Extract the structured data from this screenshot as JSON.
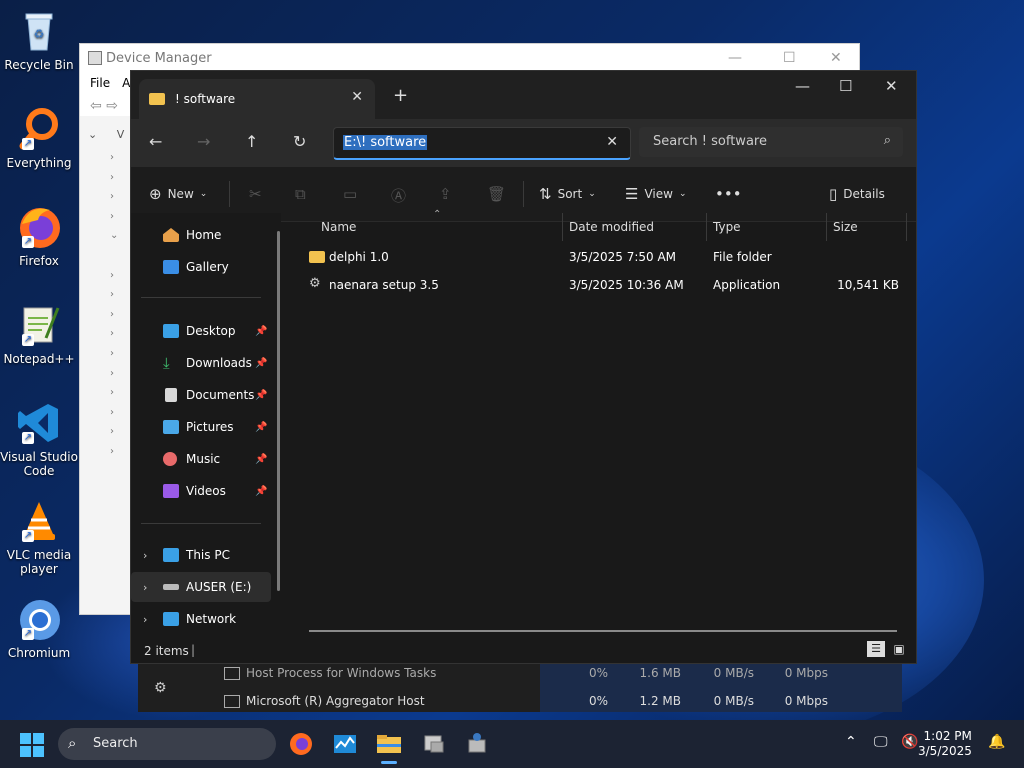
{
  "desktop": {
    "icons": [
      {
        "label": "Recycle Bin"
      },
      {
        "label": "Everything"
      },
      {
        "label": "Firefox"
      },
      {
        "label": "Notepad++"
      },
      {
        "label": "Visual Studio Code"
      },
      {
        "label": "VLC media player"
      },
      {
        "label": "Chromium"
      }
    ]
  },
  "device_manager": {
    "title": "Device Manager",
    "menu": [
      "File",
      "A"
    ],
    "tree_partial": [
      "V"
    ]
  },
  "task_manager": {
    "rows": [
      {
        "name": "Host Process for Windows Tasks",
        "cpu": "0%",
        "memory": "1.6 MB",
        "disk": "0 MB/s",
        "network": "0 Mbps"
      },
      {
        "name": "Microsoft (R) Aggregator Host",
        "cpu": "0%",
        "memory": "1.2 MB",
        "disk": "0 MB/s",
        "network": "0 Mbps"
      }
    ]
  },
  "explorer": {
    "tab_title": "! software",
    "address": "E:\\! software",
    "search_placeholder": "Search ! software",
    "commands": {
      "new": "New",
      "sort": "Sort",
      "view": "View",
      "details": "Details"
    },
    "nav": {
      "home": "Home",
      "gallery": "Gallery",
      "desktop": "Desktop",
      "downloads": "Downloads",
      "documents": "Documents",
      "pictures": "Pictures",
      "music": "Music",
      "videos": "Videos",
      "this_pc": "This PC",
      "drive": "AUSER (E:)",
      "network": "Network"
    },
    "columns": {
      "name": "Name",
      "date": "Date modified",
      "type": "Type",
      "size": "Size"
    },
    "files": [
      {
        "name": "delphi 1.0",
        "date": "3/5/2025 7:50 AM",
        "type": "File folder",
        "size": ""
      },
      {
        "name": "naenara setup 3.5",
        "date": "3/5/2025 10:36 AM",
        "type": "Application",
        "size": "10,541 KB"
      }
    ],
    "status": "2 items"
  },
  "taskbar": {
    "search_label": "Search",
    "time": "1:02 PM",
    "date": "3/5/2025"
  }
}
